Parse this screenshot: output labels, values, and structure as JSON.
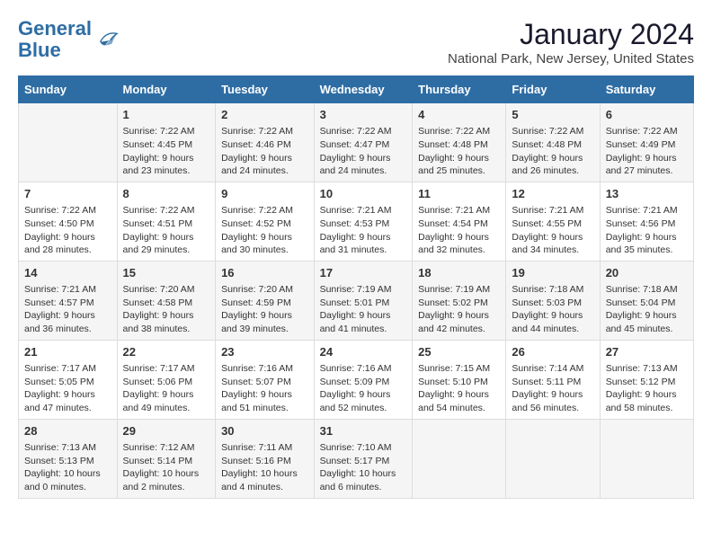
{
  "logo": {
    "line1": "General",
    "line2": "Blue"
  },
  "title": "January 2024",
  "subtitle": "National Park, New Jersey, United States",
  "days_header": [
    "Sunday",
    "Monday",
    "Tuesday",
    "Wednesday",
    "Thursday",
    "Friday",
    "Saturday"
  ],
  "weeks": [
    [
      {
        "num": "",
        "info": ""
      },
      {
        "num": "1",
        "info": "Sunrise: 7:22 AM\nSunset: 4:45 PM\nDaylight: 9 hours\nand 23 minutes."
      },
      {
        "num": "2",
        "info": "Sunrise: 7:22 AM\nSunset: 4:46 PM\nDaylight: 9 hours\nand 24 minutes."
      },
      {
        "num": "3",
        "info": "Sunrise: 7:22 AM\nSunset: 4:47 PM\nDaylight: 9 hours\nand 24 minutes."
      },
      {
        "num": "4",
        "info": "Sunrise: 7:22 AM\nSunset: 4:48 PM\nDaylight: 9 hours\nand 25 minutes."
      },
      {
        "num": "5",
        "info": "Sunrise: 7:22 AM\nSunset: 4:48 PM\nDaylight: 9 hours\nand 26 minutes."
      },
      {
        "num": "6",
        "info": "Sunrise: 7:22 AM\nSunset: 4:49 PM\nDaylight: 9 hours\nand 27 minutes."
      }
    ],
    [
      {
        "num": "7",
        "info": "Sunrise: 7:22 AM\nSunset: 4:50 PM\nDaylight: 9 hours\nand 28 minutes."
      },
      {
        "num": "8",
        "info": "Sunrise: 7:22 AM\nSunset: 4:51 PM\nDaylight: 9 hours\nand 29 minutes."
      },
      {
        "num": "9",
        "info": "Sunrise: 7:22 AM\nSunset: 4:52 PM\nDaylight: 9 hours\nand 30 minutes."
      },
      {
        "num": "10",
        "info": "Sunrise: 7:21 AM\nSunset: 4:53 PM\nDaylight: 9 hours\nand 31 minutes."
      },
      {
        "num": "11",
        "info": "Sunrise: 7:21 AM\nSunset: 4:54 PM\nDaylight: 9 hours\nand 32 minutes."
      },
      {
        "num": "12",
        "info": "Sunrise: 7:21 AM\nSunset: 4:55 PM\nDaylight: 9 hours\nand 34 minutes."
      },
      {
        "num": "13",
        "info": "Sunrise: 7:21 AM\nSunset: 4:56 PM\nDaylight: 9 hours\nand 35 minutes."
      }
    ],
    [
      {
        "num": "14",
        "info": "Sunrise: 7:21 AM\nSunset: 4:57 PM\nDaylight: 9 hours\nand 36 minutes."
      },
      {
        "num": "15",
        "info": "Sunrise: 7:20 AM\nSunset: 4:58 PM\nDaylight: 9 hours\nand 38 minutes."
      },
      {
        "num": "16",
        "info": "Sunrise: 7:20 AM\nSunset: 4:59 PM\nDaylight: 9 hours\nand 39 minutes."
      },
      {
        "num": "17",
        "info": "Sunrise: 7:19 AM\nSunset: 5:01 PM\nDaylight: 9 hours\nand 41 minutes."
      },
      {
        "num": "18",
        "info": "Sunrise: 7:19 AM\nSunset: 5:02 PM\nDaylight: 9 hours\nand 42 minutes."
      },
      {
        "num": "19",
        "info": "Sunrise: 7:18 AM\nSunset: 5:03 PM\nDaylight: 9 hours\nand 44 minutes."
      },
      {
        "num": "20",
        "info": "Sunrise: 7:18 AM\nSunset: 5:04 PM\nDaylight: 9 hours\nand 45 minutes."
      }
    ],
    [
      {
        "num": "21",
        "info": "Sunrise: 7:17 AM\nSunset: 5:05 PM\nDaylight: 9 hours\nand 47 minutes."
      },
      {
        "num": "22",
        "info": "Sunrise: 7:17 AM\nSunset: 5:06 PM\nDaylight: 9 hours\nand 49 minutes."
      },
      {
        "num": "23",
        "info": "Sunrise: 7:16 AM\nSunset: 5:07 PM\nDaylight: 9 hours\nand 51 minutes."
      },
      {
        "num": "24",
        "info": "Sunrise: 7:16 AM\nSunset: 5:09 PM\nDaylight: 9 hours\nand 52 minutes."
      },
      {
        "num": "25",
        "info": "Sunrise: 7:15 AM\nSunset: 5:10 PM\nDaylight: 9 hours\nand 54 minutes."
      },
      {
        "num": "26",
        "info": "Sunrise: 7:14 AM\nSunset: 5:11 PM\nDaylight: 9 hours\nand 56 minutes."
      },
      {
        "num": "27",
        "info": "Sunrise: 7:13 AM\nSunset: 5:12 PM\nDaylight: 9 hours\nand 58 minutes."
      }
    ],
    [
      {
        "num": "28",
        "info": "Sunrise: 7:13 AM\nSunset: 5:13 PM\nDaylight: 10 hours\nand 0 minutes."
      },
      {
        "num": "29",
        "info": "Sunrise: 7:12 AM\nSunset: 5:14 PM\nDaylight: 10 hours\nand 2 minutes."
      },
      {
        "num": "30",
        "info": "Sunrise: 7:11 AM\nSunset: 5:16 PM\nDaylight: 10 hours\nand 4 minutes."
      },
      {
        "num": "31",
        "info": "Sunrise: 7:10 AM\nSunset: 5:17 PM\nDaylight: 10 hours\nand 6 minutes."
      },
      {
        "num": "",
        "info": ""
      },
      {
        "num": "",
        "info": ""
      },
      {
        "num": "",
        "info": ""
      }
    ]
  ]
}
